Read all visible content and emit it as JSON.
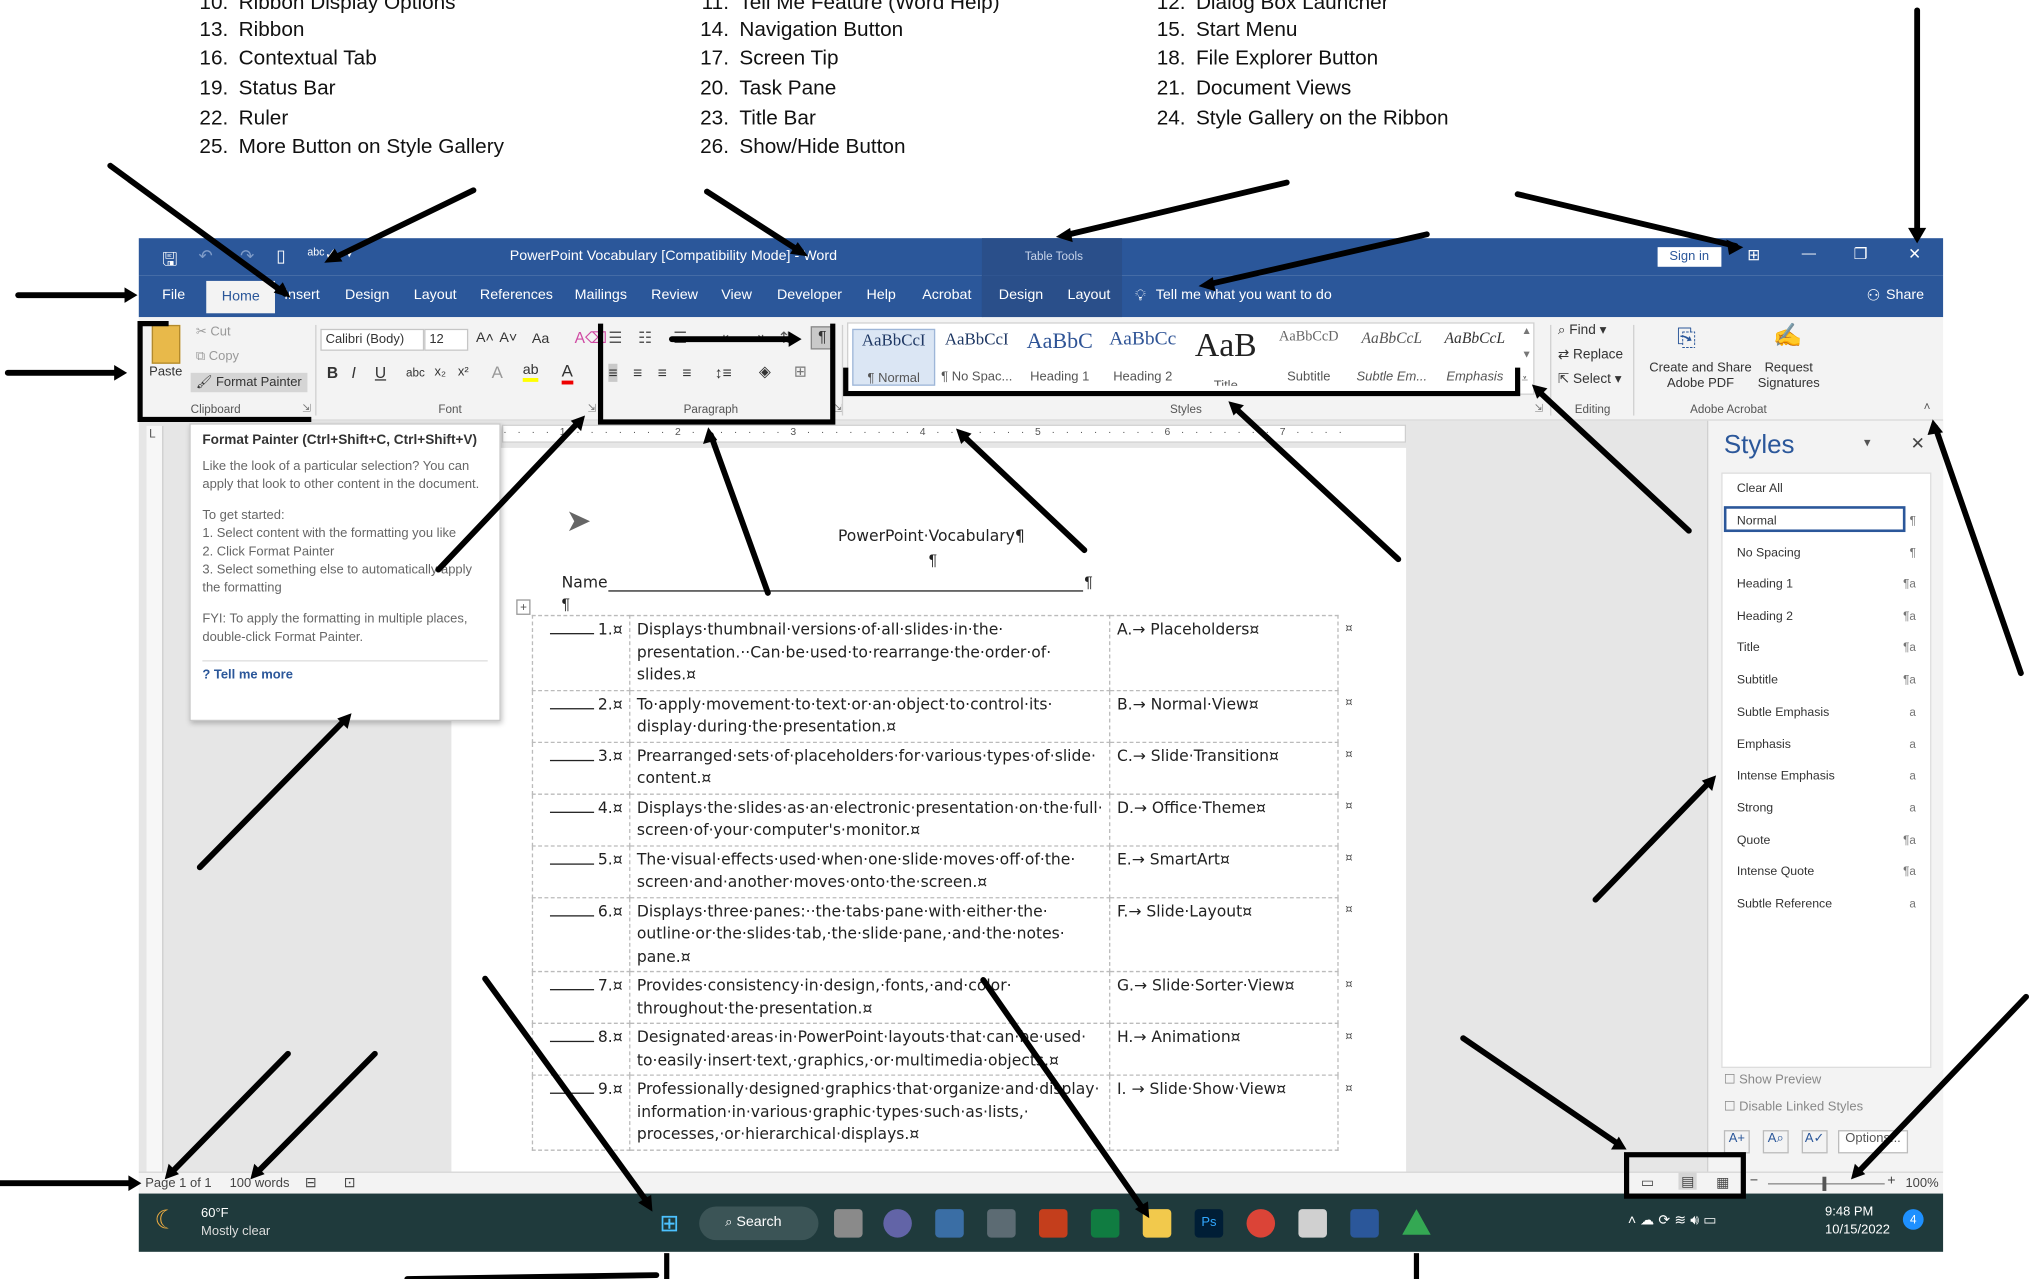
{
  "legend": [
    {
      "num": "10.",
      "label": "Ribbon Display Options"
    },
    {
      "num": "11.",
      "label": "Tell Me Feature (Word Help)"
    },
    {
      "num": "12.",
      "label": "Dialog Box Launcher"
    },
    {
      "num": "13.",
      "label": "Ribbon"
    },
    {
      "num": "14.",
      "label": "Navigation Button"
    },
    {
      "num": "15.",
      "label": "Start Menu"
    },
    {
      "num": "16.",
      "label": "Contextual Tab"
    },
    {
      "num": "17.",
      "label": "Screen Tip"
    },
    {
      "num": "18.",
      "label": "File Explorer Button"
    },
    {
      "num": "19.",
      "label": "Status Bar"
    },
    {
      "num": "20.",
      "label": "Task Pane"
    },
    {
      "num": "21.",
      "label": "Document Views"
    },
    {
      "num": "22.",
      "label": "Ruler"
    },
    {
      "num": "23.",
      "label": "Title Bar"
    },
    {
      "num": "24.",
      "label": "Style Gallery on the Ribbon"
    },
    {
      "num": "25.",
      "label": "More Button on Style Gallery"
    },
    {
      "num": "26.",
      "label": "Show/Hide Button"
    }
  ],
  "titlebar": {
    "title": "PowerPoint Vocabulary [Compatibility Mode]  -  Word",
    "context_group": "Table Tools",
    "sign_in": "Sign in",
    "minimize": "—",
    "restore": "❐",
    "close": "✕"
  },
  "tabs": {
    "file": "File",
    "home": "Home",
    "insert": "Insert",
    "design": "Design",
    "layout": "Layout",
    "references": "References",
    "mailings": "Mailings",
    "review": "Review",
    "view": "View",
    "developer": "Developer",
    "help": "Help",
    "acrobat": "Acrobat",
    "table_design": "Design",
    "table_layout": "Layout",
    "tell_me": "Tell me what you want to do",
    "share": "Share"
  },
  "ribbon": {
    "clipboard": {
      "paste": "Paste",
      "cut": "Cut",
      "copy": "Copy",
      "format_painter": "Format Painter",
      "label": "Clipboard"
    },
    "font": {
      "font_name": "Calibri (Body)",
      "font_size": "12",
      "case": "Aa",
      "label": "Font"
    },
    "paragraph": {
      "label": "Paragraph",
      "show_hide": "¶"
    },
    "styles": {
      "label": "Styles",
      "gallery": [
        {
          "sample": "AaBbCcI",
          "name": "¶ Normal"
        },
        {
          "sample": "AaBbCcI",
          "name": "¶ No Spac..."
        },
        {
          "sample": "AaBbC",
          "name": "Heading 1"
        },
        {
          "sample": "AaBbCc",
          "name": "Heading 2"
        },
        {
          "sample": "AaB",
          "name": "Title"
        },
        {
          "sample": "AaBbCcD",
          "name": "Subtitle"
        },
        {
          "sample": "AaBbCcL",
          "name": "Subtle Em..."
        },
        {
          "sample": "AaBbCcL",
          "name": "Emphasis"
        }
      ]
    },
    "editing": {
      "find": "Find",
      "replace": "Replace",
      "select": "Select",
      "label": "Editing"
    },
    "acrobat": {
      "create_share": "Create and Share Adobe PDF",
      "request": "Request Signatures",
      "label": "Adobe Acrobat"
    }
  },
  "tooltip": {
    "title": "Format Painter (Ctrl+Shift+C, Ctrl+Shift+V)",
    "desc": "Like the look of a particular selection? You can apply that look to other content in the document.",
    "get_started": "To get started:",
    "step1": "1. Select content with the formatting you like",
    "step2": "2. Click Format Painter",
    "step3": "3. Select something else to automatically apply the formatting",
    "fyi": "FYI: To apply the formatting in multiple places, double-click Format Painter.",
    "tell_more": "Tell me more"
  },
  "document": {
    "heading": "PowerPoint·Vocabulary¶",
    "pilcrow": "¶",
    "name_label": "Name",
    "name_end": "¶",
    "rows": [
      {
        "num": "1.¤",
        "desc": "Displays·thumbnail·versions·of·all·slides·in·the· presentation.··Can·be·used·to·rearrange·the·order·of· slides.¤",
        "answer": "A.→ Placeholders¤"
      },
      {
        "num": "2.¤",
        "desc": "To·apply·movement·to·text·or·an·object·to·control·its· display·during·the·presentation.¤",
        "answer": "B.→ Normal·View¤"
      },
      {
        "num": "3.¤",
        "desc": "Prearranged·sets·of·placeholders·for·various·types·of·slide· content.¤",
        "answer": "C.→ Slide·Transition¤"
      },
      {
        "num": "4.¤",
        "desc": "Displays·the·slides·as·an·electronic·presentation·on·the·full· screen·of·your·computer's·monitor.¤",
        "answer": "D.→ Office·Theme¤"
      },
      {
        "num": "5.¤",
        "desc": "The·visual·effects·used·when·one·slide·moves·off·of·the· screen·and·another·moves·onto·the·screen.¤",
        "answer": "E.→ SmartArt¤"
      },
      {
        "num": "6.¤",
        "desc": "Displays·three·panes:··the·tabs·pane·with·either·the· outline·or·the·slides·tab,·the·slide·pane,·and·the·notes· pane.¤",
        "answer": "F.→ Slide·Layout¤"
      },
      {
        "num": "7.¤",
        "desc": "Provides·consistency·in·design,·fonts,·and·color· throughout·the·presentation.¤",
        "answer": "G.→ Slide·Sorter·View¤"
      },
      {
        "num": "8.¤",
        "desc": "Designated·areas·in·PowerPoint·layouts·that·can·be·used· to·easily·insert·text,·graphics,·or·multimedia·objects.¤",
        "answer": "H.→ Animation¤"
      },
      {
        "num": "9.¤",
        "desc": "Professionally·designed·graphics·that·organize·and·display· information·in·various·graphic·types·such·as·lists,· processes,·or·hierarchical·displays.¤",
        "answer": "I. → Slide·Show·View¤"
      }
    ],
    "cell_end": "¤"
  },
  "styles_pane": {
    "title": "Styles",
    "items": [
      "Clear All",
      "Normal",
      "No Spacing",
      "Heading 1",
      "Heading 2",
      "Title",
      "Subtitle",
      "Subtle Emphasis",
      "Emphasis",
      "Intense Emphasis",
      "Strong",
      "Quote",
      "Intense Quote",
      "Subtle Reference"
    ],
    "marks": [
      "",
      "¶",
      "¶",
      "¶a",
      "¶a",
      "¶a",
      "¶a",
      "a",
      "a",
      "a",
      "a",
      "¶a",
      "¶a",
      "a"
    ],
    "show_preview": "Show Preview",
    "disable_linked": "Disable Linked Styles",
    "options": "Options..."
  },
  "statusbar": {
    "page": "Page 1 of 1",
    "words": "100 words",
    "zoom": "100%"
  },
  "taskbar": {
    "temp": "60°F",
    "weather": "Mostly clear",
    "search": "Search",
    "time": "9:48 PM",
    "date": "10/15/2022"
  },
  "colors": {
    "word_blue": "#2b579a",
    "taskbar": "#1f3a3c",
    "arrow": "#000000"
  }
}
